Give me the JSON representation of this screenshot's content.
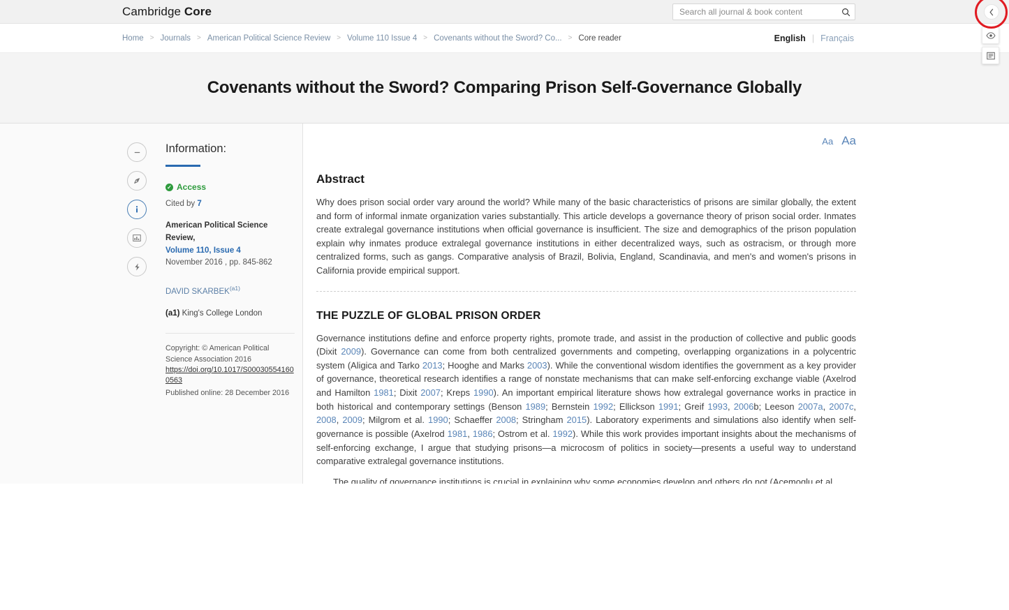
{
  "header": {
    "brand_light": "Cambridge ",
    "brand_bold": "Core",
    "search_placeholder": "Search all journal & book content",
    "search_value": "",
    "search_icon": "search-icon",
    "collapse_icon": "chevron-left-icon"
  },
  "breadcrumb": {
    "items": [
      {
        "label": "Home",
        "current": false
      },
      {
        "label": "Journals",
        "current": false
      },
      {
        "label": "American Political Science Review",
        "current": false
      },
      {
        "label": "Volume 110 Issue 4",
        "current": false
      },
      {
        "label": "Covenants without the Sword? Co...",
        "current": false
      },
      {
        "label": "Core reader",
        "current": true
      }
    ],
    "separator": ">"
  },
  "language": {
    "english": "English",
    "divider": "|",
    "francais": "Français"
  },
  "title": "Covenants without the Sword? Comparing Prison Self-Governance Globally",
  "sidebar": {
    "rail": [
      {
        "name": "collapse-minus-icon",
        "glyph": "−",
        "active": false
      },
      {
        "name": "compass-icon",
        "glyph": "◓",
        "active": false
      },
      {
        "name": "info-icon",
        "glyph": "i",
        "active": true
      },
      {
        "name": "figures-chart-icon",
        "glyph": "▥",
        "active": false
      },
      {
        "name": "metrics-lightning-icon",
        "glyph": "⚡",
        "active": false
      }
    ],
    "heading": "Information:",
    "access_label": "Access",
    "access_check": "✓",
    "cited_by_prefix": "Cited by ",
    "cited_by_count": "7",
    "journal_name": "American Political Science Review,",
    "volume_issue": "Volume 110, Issue 4",
    "issue_date": "November 2016 , pp. 845-862",
    "author": "DAVID SKARBEK",
    "author_affil_marker": "(a1)",
    "affil_marker": "(a1)",
    "affil_name": "King's College London",
    "copyright": "Copyright: © American Political Science Association 2016",
    "doi": "https://doi.org/10.1017/S000305541600563",
    "published_online": "Published online: 28 December 2016"
  },
  "article": {
    "font_small_label": "Aa",
    "font_large_label": "Aa",
    "abstract_heading": "Abstract",
    "abstract_text": "Why does prison social order vary around the world? While many of the basic characteristics of prisons are similar globally, the extent and form of informal inmate organization varies substantially. This article develops a governance theory of prison social order. Inmates create extralegal governance institutions when official governance is insufficient. The size and demographics of the prison population explain why inmates produce extralegal governance institutions in either decentralized ways, such as ostracism, or through more centralized forms, such as gangs. Comparative analysis of Brazil, Bolivia, England, Scandinavia, and men's and women's prisons in California provide empirical support.",
    "section_heading": "THE PUZZLE OF GLOBAL PRISON ORDER",
    "para1_parts": [
      {
        "t": "Governance institutions define and enforce property rights, promote trade, and assist in the production of collective and public goods (Dixit "
      },
      {
        "t": "2009",
        "ref": true
      },
      {
        "t": "). Governance can come from both centralized governments and competing, overlapping organizations in a polycentric system (Aligica and Tarko "
      },
      {
        "t": "2013",
        "ref": true
      },
      {
        "t": "; Hooghe and Marks "
      },
      {
        "t": "2003",
        "ref": true
      },
      {
        "t": "). While the conventional wisdom identifies the government as a key provider of governance, theoretical research identifies a range of nonstate mechanisms that can make self-enforcing exchange viable (Axelrod and Hamilton "
      },
      {
        "t": "1981",
        "ref": true
      },
      {
        "t": "; Dixit "
      },
      {
        "t": "2007",
        "ref": true
      },
      {
        "t": "; Kreps "
      },
      {
        "t": "1990",
        "ref": true
      },
      {
        "t": "). An important empirical literature shows how extralegal governance works in practice in both historical and contemporary settings (Benson "
      },
      {
        "t": "1989",
        "ref": true
      },
      {
        "t": "; Bernstein "
      },
      {
        "t": "1992",
        "ref": true
      },
      {
        "t": "; Ellickson "
      },
      {
        "t": "1991",
        "ref": true
      },
      {
        "t": "; Greif "
      },
      {
        "t": "1993",
        "ref": true
      },
      {
        "t": ", "
      },
      {
        "t": "2006",
        "ref": true
      },
      {
        "t": "b; Leeson "
      },
      {
        "t": "2007a",
        "ref": true
      },
      {
        "t": ", "
      },
      {
        "t": "2007c",
        "ref": true
      },
      {
        "t": ", "
      },
      {
        "t": "2008",
        "ref": true
      },
      {
        "t": ", "
      },
      {
        "t": "2009",
        "ref": true
      },
      {
        "t": "; Milgrom et al. "
      },
      {
        "t": "1990",
        "ref": true
      },
      {
        "t": "; Schaeffer "
      },
      {
        "t": "2008",
        "ref": true
      },
      {
        "t": "; Stringham "
      },
      {
        "t": "2015",
        "ref": true
      },
      {
        "t": "). Laboratory experiments and simulations also identify when self-governance is possible (Axelrod "
      },
      {
        "t": "1981",
        "ref": true
      },
      {
        "t": ", "
      },
      {
        "t": "1986",
        "ref": true
      },
      {
        "t": "; Ostrom et al. "
      },
      {
        "t": "1992",
        "ref": true
      },
      {
        "t": "). While this work provides important insights about the mechanisms of self-enforcing exchange, I argue that studying prisons—a microcosm of politics in society—presents a useful way to understand comparative extralegal governance institutions."
      }
    ],
    "para2_parts": [
      {
        "t": "The quality of governance institutions is crucial in explaining why some economies develop and others do not (Acemoglu et al."
      }
    ]
  },
  "float_tools": [
    {
      "name": "eye-preview-icon",
      "glyph": "eye"
    },
    {
      "name": "notes-icon",
      "glyph": "notes"
    }
  ]
}
